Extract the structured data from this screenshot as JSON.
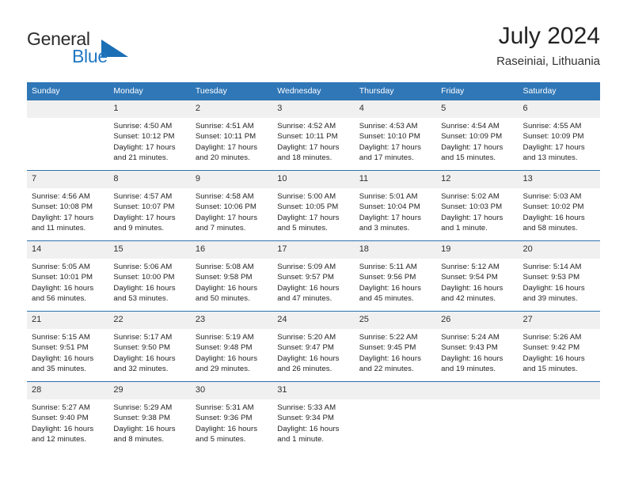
{
  "brand": {
    "name_top": "General",
    "name_bottom": "Blue",
    "triangle_color": "#1a6fb5",
    "top_color": "#2b2b2b",
    "bottom_color": "#2077c3"
  },
  "header": {
    "title": "July 2024",
    "subtitle": "Raseiniai, Lithuania"
  },
  "colors": {
    "header_blue": "#3077b7",
    "row_divider": "#2f72ad",
    "daynum_band": "#f0f0f0"
  },
  "weekday_headers": [
    "Sunday",
    "Monday",
    "Tuesday",
    "Wednesday",
    "Thursday",
    "Friday",
    "Saturday"
  ],
  "weeks": [
    [
      {
        "day": "",
        "lines": []
      },
      {
        "day": "1",
        "lines": [
          "Sunrise: 4:50 AM",
          "Sunset: 10:12 PM",
          "Daylight: 17 hours",
          "and 21 minutes."
        ]
      },
      {
        "day": "2",
        "lines": [
          "Sunrise: 4:51 AM",
          "Sunset: 10:11 PM",
          "Daylight: 17 hours",
          "and 20 minutes."
        ]
      },
      {
        "day": "3",
        "lines": [
          "Sunrise: 4:52 AM",
          "Sunset: 10:11 PM",
          "Daylight: 17 hours",
          "and 18 minutes."
        ]
      },
      {
        "day": "4",
        "lines": [
          "Sunrise: 4:53 AM",
          "Sunset: 10:10 PM",
          "Daylight: 17 hours",
          "and 17 minutes."
        ]
      },
      {
        "day": "5",
        "lines": [
          "Sunrise: 4:54 AM",
          "Sunset: 10:09 PM",
          "Daylight: 17 hours",
          "and 15 minutes."
        ]
      },
      {
        "day": "6",
        "lines": [
          "Sunrise: 4:55 AM",
          "Sunset: 10:09 PM",
          "Daylight: 17 hours",
          "and 13 minutes."
        ]
      }
    ],
    [
      {
        "day": "7",
        "lines": [
          "Sunrise: 4:56 AM",
          "Sunset: 10:08 PM",
          "Daylight: 17 hours",
          "and 11 minutes."
        ]
      },
      {
        "day": "8",
        "lines": [
          "Sunrise: 4:57 AM",
          "Sunset: 10:07 PM",
          "Daylight: 17 hours",
          "and 9 minutes."
        ]
      },
      {
        "day": "9",
        "lines": [
          "Sunrise: 4:58 AM",
          "Sunset: 10:06 PM",
          "Daylight: 17 hours",
          "and 7 minutes."
        ]
      },
      {
        "day": "10",
        "lines": [
          "Sunrise: 5:00 AM",
          "Sunset: 10:05 PM",
          "Daylight: 17 hours",
          "and 5 minutes."
        ]
      },
      {
        "day": "11",
        "lines": [
          "Sunrise: 5:01 AM",
          "Sunset: 10:04 PM",
          "Daylight: 17 hours",
          "and 3 minutes."
        ]
      },
      {
        "day": "12",
        "lines": [
          "Sunrise: 5:02 AM",
          "Sunset: 10:03 PM",
          "Daylight: 17 hours",
          "and 1 minute."
        ]
      },
      {
        "day": "13",
        "lines": [
          "Sunrise: 5:03 AM",
          "Sunset: 10:02 PM",
          "Daylight: 16 hours",
          "and 58 minutes."
        ]
      }
    ],
    [
      {
        "day": "14",
        "lines": [
          "Sunrise: 5:05 AM",
          "Sunset: 10:01 PM",
          "Daylight: 16 hours",
          "and 56 minutes."
        ]
      },
      {
        "day": "15",
        "lines": [
          "Sunrise: 5:06 AM",
          "Sunset: 10:00 PM",
          "Daylight: 16 hours",
          "and 53 minutes."
        ]
      },
      {
        "day": "16",
        "lines": [
          "Sunrise: 5:08 AM",
          "Sunset: 9:58 PM",
          "Daylight: 16 hours",
          "and 50 minutes."
        ]
      },
      {
        "day": "17",
        "lines": [
          "Sunrise: 5:09 AM",
          "Sunset: 9:57 PM",
          "Daylight: 16 hours",
          "and 47 minutes."
        ]
      },
      {
        "day": "18",
        "lines": [
          "Sunrise: 5:11 AM",
          "Sunset: 9:56 PM",
          "Daylight: 16 hours",
          "and 45 minutes."
        ]
      },
      {
        "day": "19",
        "lines": [
          "Sunrise: 5:12 AM",
          "Sunset: 9:54 PM",
          "Daylight: 16 hours",
          "and 42 minutes."
        ]
      },
      {
        "day": "20",
        "lines": [
          "Sunrise: 5:14 AM",
          "Sunset: 9:53 PM",
          "Daylight: 16 hours",
          "and 39 minutes."
        ]
      }
    ],
    [
      {
        "day": "21",
        "lines": [
          "Sunrise: 5:15 AM",
          "Sunset: 9:51 PM",
          "Daylight: 16 hours",
          "and 35 minutes."
        ]
      },
      {
        "day": "22",
        "lines": [
          "Sunrise: 5:17 AM",
          "Sunset: 9:50 PM",
          "Daylight: 16 hours",
          "and 32 minutes."
        ]
      },
      {
        "day": "23",
        "lines": [
          "Sunrise: 5:19 AM",
          "Sunset: 9:48 PM",
          "Daylight: 16 hours",
          "and 29 minutes."
        ]
      },
      {
        "day": "24",
        "lines": [
          "Sunrise: 5:20 AM",
          "Sunset: 9:47 PM",
          "Daylight: 16 hours",
          "and 26 minutes."
        ]
      },
      {
        "day": "25",
        "lines": [
          "Sunrise: 5:22 AM",
          "Sunset: 9:45 PM",
          "Daylight: 16 hours",
          "and 22 minutes."
        ]
      },
      {
        "day": "26",
        "lines": [
          "Sunrise: 5:24 AM",
          "Sunset: 9:43 PM",
          "Daylight: 16 hours",
          "and 19 minutes."
        ]
      },
      {
        "day": "27",
        "lines": [
          "Sunrise: 5:26 AM",
          "Sunset: 9:42 PM",
          "Daylight: 16 hours",
          "and 15 minutes."
        ]
      }
    ],
    [
      {
        "day": "28",
        "lines": [
          "Sunrise: 5:27 AM",
          "Sunset: 9:40 PM",
          "Daylight: 16 hours",
          "and 12 minutes."
        ]
      },
      {
        "day": "29",
        "lines": [
          "Sunrise: 5:29 AM",
          "Sunset: 9:38 PM",
          "Daylight: 16 hours",
          "and 8 minutes."
        ]
      },
      {
        "day": "30",
        "lines": [
          "Sunrise: 5:31 AM",
          "Sunset: 9:36 PM",
          "Daylight: 16 hours",
          "and 5 minutes."
        ]
      },
      {
        "day": "31",
        "lines": [
          "Sunrise: 5:33 AM",
          "Sunset: 9:34 PM",
          "Daylight: 16 hours",
          "and 1 minute."
        ]
      },
      {
        "day": "",
        "lines": []
      },
      {
        "day": "",
        "lines": []
      },
      {
        "day": "",
        "lines": []
      }
    ]
  ]
}
